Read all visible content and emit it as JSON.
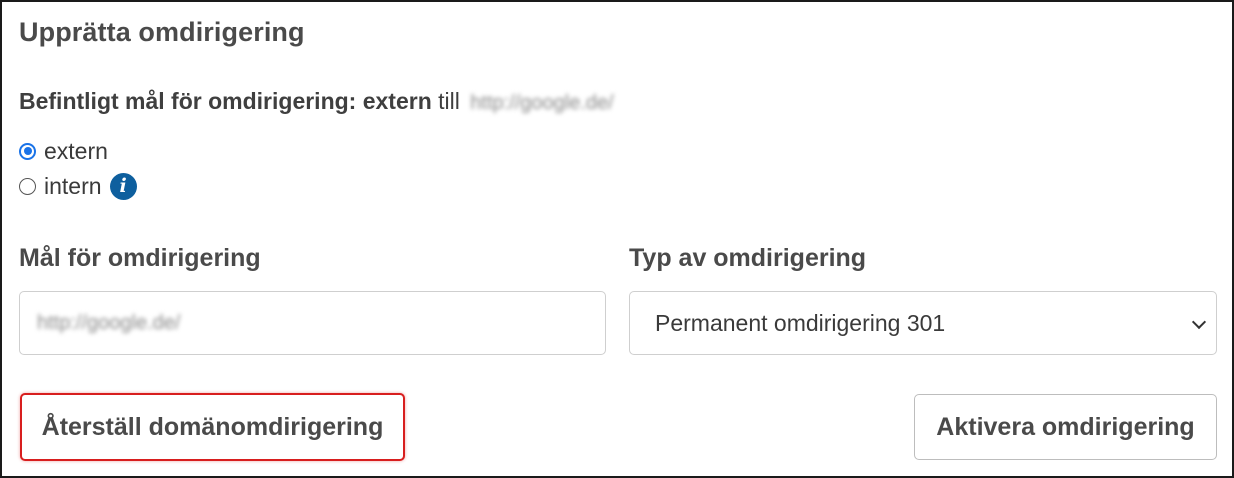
{
  "title": "Upprätta omdirigering",
  "current": {
    "prefix": "Befintligt mål för omdirigering: extern",
    "connector": "till",
    "url": "http://google.de/"
  },
  "radios": [
    {
      "label": "extern",
      "checked": true
    },
    {
      "label": "intern",
      "checked": false
    }
  ],
  "icons": {
    "info": "i"
  },
  "target": {
    "label": "Mål för omdirigering",
    "value": "http://google.de/"
  },
  "type": {
    "label": "Typ av omdirigering",
    "selected": "Permanent omdirigering 301"
  },
  "buttons": {
    "reset": "Återställ domänomdirigering",
    "activate": "Aktivera omdirigering"
  },
  "colors": {
    "accent": "#1a73e8",
    "info": "#0e5f9e",
    "highlight": "#d81e1e"
  }
}
